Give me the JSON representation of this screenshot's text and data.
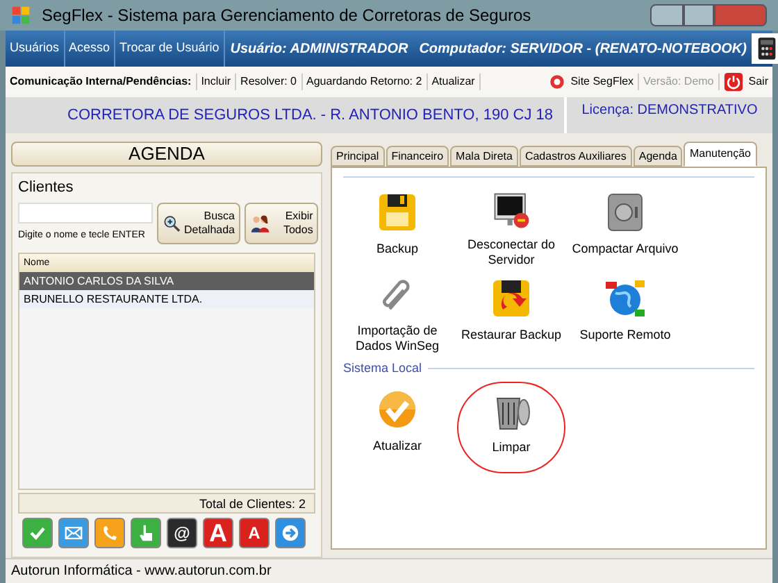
{
  "window": {
    "title": "SegFlex - Sistema para Gerenciamento de Corretoras de Seguros"
  },
  "menu": {
    "items": [
      "Usuários",
      "Acesso",
      "Trocar de Usuário"
    ],
    "user": "Usuário: ADMINISTRADOR",
    "computer": "Computador: SERVIDOR - (RENATO-NOTEBOOK)"
  },
  "toolbar": {
    "label": "Comunicação Interna/Pendências:",
    "items": [
      "Incluir",
      "Resolver: 0",
      "Aguardando Retorno: 2",
      "Atualizar"
    ],
    "site": "Site SegFlex",
    "version": "Versão: Demo",
    "exit": "Sair"
  },
  "info": {
    "company": "CORRETORA DE SEGUROS LTDA. - R. ANTONIO BENTO, 190 CJ 18",
    "license": "Licença: DEMONSTRATIVO"
  },
  "agenda": {
    "title": "AGENDA",
    "group": "Clientes",
    "hint": "Digite o nome e tecle ENTER",
    "buttons": [
      {
        "kind": "search",
        "label": "Busca Detalhada"
      },
      {
        "kind": "people",
        "label": "Exibir Todos"
      }
    ],
    "column": "Nome",
    "rows": [
      {
        "name": "ANTONIO CARLOS DA SILVA",
        "selected": true
      },
      {
        "name": "BRUNELLO RESTAURANTE LTDA.",
        "selected": false
      }
    ],
    "total": "Total de Clientes: 2"
  },
  "actions": [
    {
      "kind": "check"
    },
    {
      "kind": "mail"
    },
    {
      "kind": "phone"
    },
    {
      "kind": "hand"
    },
    {
      "kind": "at",
      "label": "@"
    },
    {
      "kind": "letter",
      "label": "A"
    },
    {
      "kind": "letter-small",
      "label": "A"
    },
    {
      "kind": "arrow"
    }
  ],
  "tabs": [
    {
      "label": "Principal",
      "selected": false
    },
    {
      "label": "Financeiro",
      "selected": false
    },
    {
      "label": "Mala Direta",
      "selected": false
    },
    {
      "label": "Cadastros Auxiliares",
      "selected": false
    },
    {
      "label": "Agenda",
      "selected": false
    },
    {
      "label": "Manutenção",
      "selected": true
    }
  ],
  "tools": [
    {
      "kind": "floppy",
      "label": "Backup",
      "highlighted": false
    },
    {
      "kind": "monitor",
      "label": "Desconectar do Servidor",
      "highlighted": false
    },
    {
      "kind": "safe",
      "label": "Compactar Arquivo",
      "highlighted": false
    },
    {
      "kind": "clip",
      "label": "Importação de Dados WinSeg",
      "highlighted": false
    },
    {
      "kind": "restore",
      "label": "Restaurar Backup",
      "highlighted": false
    },
    {
      "kind": "globe",
      "label": "Suporte Remoto",
      "highlighted": false
    }
  ],
  "local": {
    "title": "Sistema Local",
    "tools": [
      {
        "kind": "update",
        "label": "Atualizar",
        "highlighted": false
      },
      {
        "kind": "trash",
        "label": "Limpar",
        "highlighted": true
      }
    ]
  },
  "status_bar": "Autorun Informática - www.autorun.com.br"
}
